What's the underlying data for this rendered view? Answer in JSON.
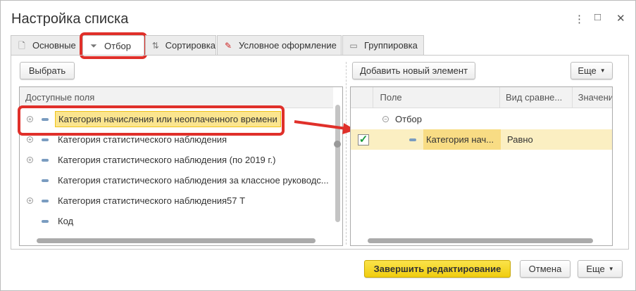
{
  "window": {
    "title": "Настройка списка"
  },
  "tabs": [
    {
      "label": "Основные",
      "icon": "document-icon"
    },
    {
      "label": "Отбор",
      "icon": "filter-icon",
      "active": true
    },
    {
      "label": "Сортировка",
      "icon": "sort-icon"
    },
    {
      "label": "Условное оформление",
      "icon": "brush-icon"
    },
    {
      "label": "Группировка",
      "icon": "grouping-icon"
    }
  ],
  "left": {
    "choose_label": "Выбрать",
    "header": "Доступные поля",
    "items": [
      {
        "label": "Категория начисления или неоплаченного времени",
        "expandable": true,
        "selected": true
      },
      {
        "label": "Категория статистического наблюдения",
        "expandable": true
      },
      {
        "label": "Категория статистического наблюдения (по 2019 г.)",
        "expandable": true
      },
      {
        "label": "Категория статистического наблюдения за классное руководс...",
        "expandable": false
      },
      {
        "label": "Категория статистического наблюдения57 Т",
        "expandable": true
      },
      {
        "label": "Код",
        "expandable": false
      }
    ]
  },
  "right": {
    "add_label": "Добавить новый элемент",
    "more_label": "Еще",
    "columns": [
      "Поле",
      "Вид сравне...",
      "Значени"
    ],
    "group": "Отбор",
    "rows": [
      {
        "checked": true,
        "field": "Категория нач...",
        "comparison": "Равно",
        "value": ""
      }
    ]
  },
  "footer": {
    "finish_label": "Завершить редактирование",
    "cancel_label": "Отмена",
    "more_label": "Еще"
  },
  "colors": {
    "highlight": "#e0302a",
    "accent": "#f5d22d",
    "selected_row": "#fbefc2"
  }
}
